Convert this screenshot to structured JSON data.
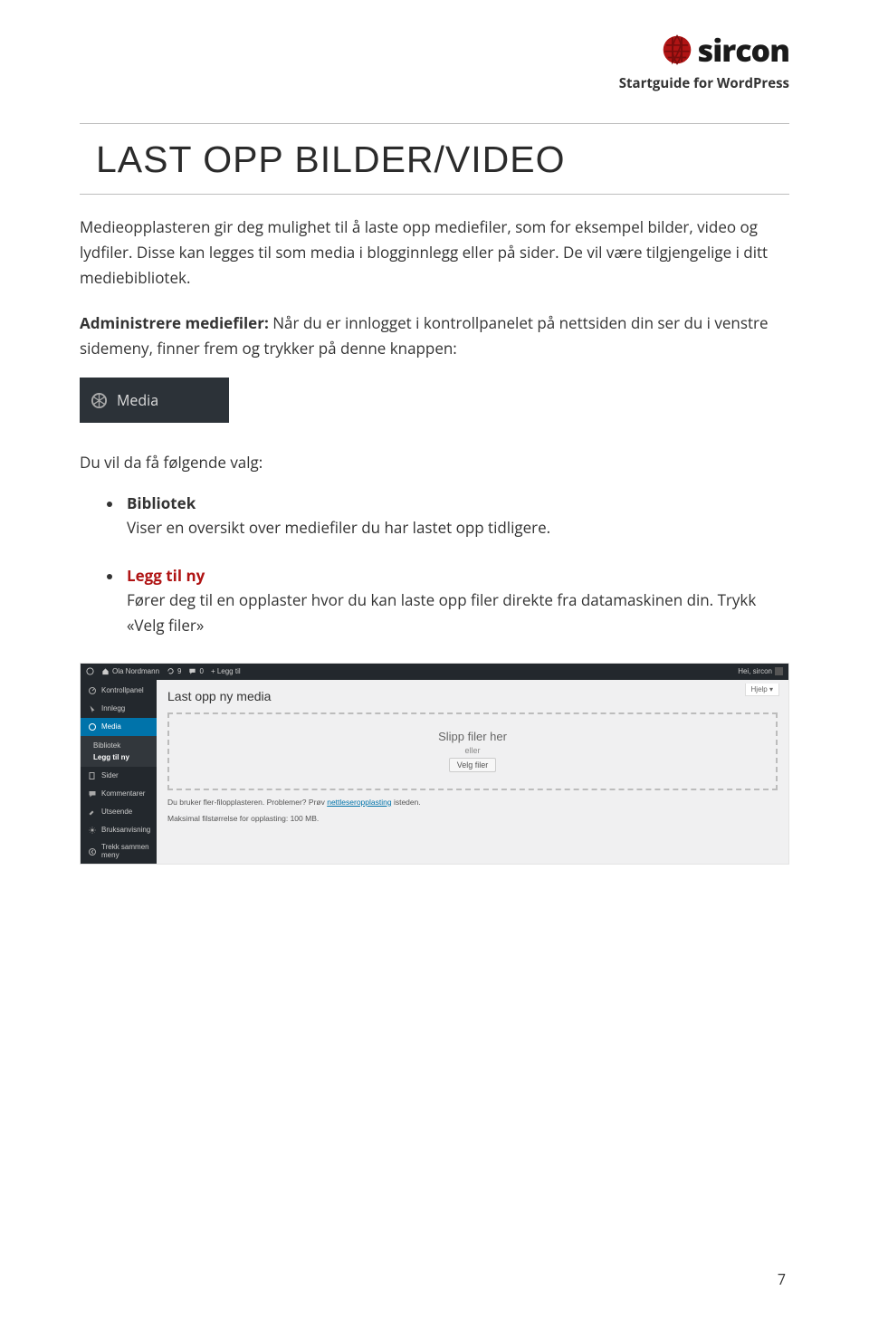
{
  "header": {
    "brand": "sircon",
    "subtitle": "Startguide for WordPress"
  },
  "title": "LAST OPP BILDER/VIDEO",
  "intro_para": "Medieopplasteren gir deg mulighet til å laste opp mediefiler, som for eksempel bilder, video og lydfiler. Disse kan legges til som media i blogginnlegg eller på sider. De vil være tilgjengelige i ditt mediebibliotek.",
  "admin_para_bold": "Administrere mediefiler:",
  "admin_para_rest": " Når du er innlogget i kontrollpanelet på nettsiden din ser du i venstre sidemeny, finner frem og trykker på denne knappen:",
  "media_chip": "Media",
  "followup": "Du vil da få følgende valg:",
  "choices": [
    {
      "title": "Bibliotek",
      "title_style": "plain",
      "desc": "Viser en oversikt over mediefiler du har lastet opp tidligere."
    },
    {
      "title": "Legg til ny",
      "title_style": "red",
      "desc": "Fører deg til en opplaster hvor du kan laste opp filer direkte fra datamaskinen din. Trykk «Velg filer»"
    }
  ],
  "wp": {
    "topbar": {
      "site": "Ola Nordmann",
      "updates": "9",
      "comments": "0",
      "add": "+ Legg til",
      "greeting": "Hei, sircon"
    },
    "sidebar": {
      "items": [
        {
          "label": "Kontrollpanel"
        },
        {
          "label": "Innlegg"
        },
        {
          "label": "Media",
          "active": true
        },
        {
          "label": "Sider"
        },
        {
          "label": "Kommentarer"
        },
        {
          "label": "Utseende"
        },
        {
          "label": "Bruksanvisning"
        },
        {
          "label": "Trekk sammen meny"
        }
      ],
      "sub_media": [
        {
          "label": "Bibliotek"
        },
        {
          "label": "Legg til ny",
          "selected": true
        }
      ]
    },
    "main": {
      "help_tab": "Hjelp",
      "heading": "Last opp ny media",
      "drop_main": "Slipp filer her",
      "drop_or": "eller",
      "choose_btn": "Velg filer",
      "note1_pre": "Du bruker fler-filopplasteren. Problemer? Prøv ",
      "note1_link": "nettleseropplasting",
      "note1_post": " isteden.",
      "note2": "Maksimal filstørrelse for opplasting: 100 MB."
    }
  },
  "page_number": "7"
}
